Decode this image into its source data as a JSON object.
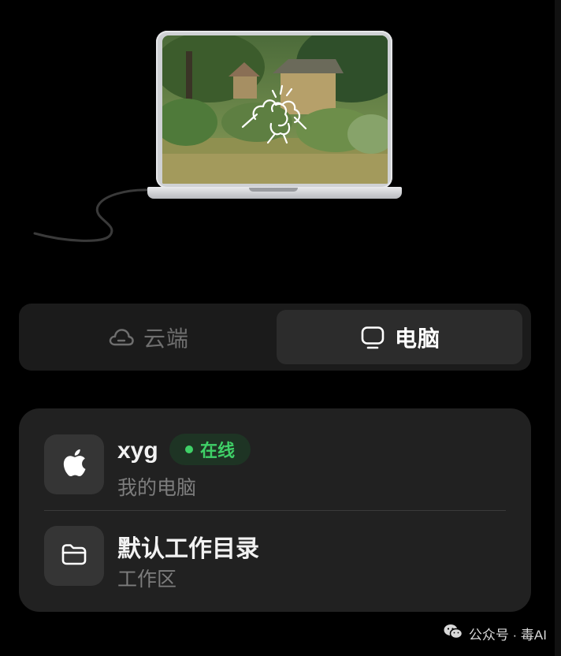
{
  "tabs": {
    "cloud": {
      "label": "云端",
      "icon": "cloud-icon",
      "selected": false
    },
    "computer": {
      "label": "电脑",
      "icon": "monitor-icon",
      "selected": true
    }
  },
  "device": {
    "name": "xyg",
    "status": "在线",
    "status_color": "#3fd067",
    "subtitle": "我的电脑",
    "icon": "apple-icon"
  },
  "workspace": {
    "title": "默认工作目录",
    "subtitle": "工作区",
    "icon": "folder-icon"
  },
  "watermark": {
    "text": "公众号 · 毒AI",
    "icon": "wechat-icon"
  },
  "colors": {
    "background": "#000000",
    "card": "#212121",
    "tab_selected": "#2c2c2c",
    "online_green": "#3fd067"
  }
}
